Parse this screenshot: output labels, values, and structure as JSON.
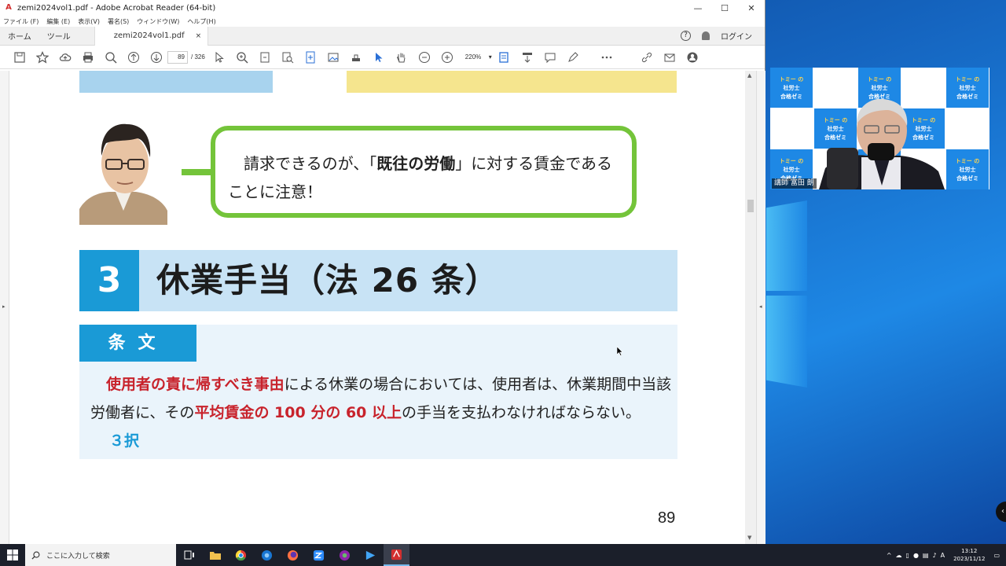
{
  "window": {
    "app_icon": "acrobat-icon",
    "title": "zemi2024vol1.pdf - Adobe Acrobat Reader (64-bit)"
  },
  "menu": [
    "ファイル (F)",
    "編集 (E)",
    "表示(V)",
    "署名(S)",
    "ウィンドウ(W)",
    "ヘルプ(H)"
  ],
  "tabs": {
    "home": "ホーム",
    "tools": "ツール",
    "doc": "zemi2024vol1.pdf",
    "close": "×",
    "login": "ログイン"
  },
  "toolbar": {
    "page_current": "89",
    "page_total": "/ 326",
    "zoom": "220%"
  },
  "document": {
    "bubble_pre": "請求できるのが、「",
    "bubble_bold": "既往の労働",
    "bubble_post": "」に対する賃金であることに注意！",
    "section_number": "3",
    "section_title": "休業手当（法 26 条）",
    "article_label": "条文",
    "article_red1": "使用者の責に帰すべき事由",
    "article_mid1": "による休業の場合においては、使用者は、休業期間中当該労働者に、その",
    "article_red2": "平均賃金の 100 分の 60 以上",
    "article_mid2": "の手当を支払わなければならない。",
    "article_badge": "３択",
    "page_number": "89"
  },
  "video": {
    "cell_line1": "トミー の",
    "cell_line2": "社労士",
    "cell_line3": "合格ゼミ",
    "name": "講師 富田 朗"
  },
  "taskbar": {
    "search_placeholder": "ここに入力して検索",
    "time": "13:12",
    "date": "2023/11/12"
  },
  "colors": {
    "accent_blue": "#1a9ad6",
    "bubble_green": "#74c43a",
    "highlight_red": "#c8232c"
  }
}
